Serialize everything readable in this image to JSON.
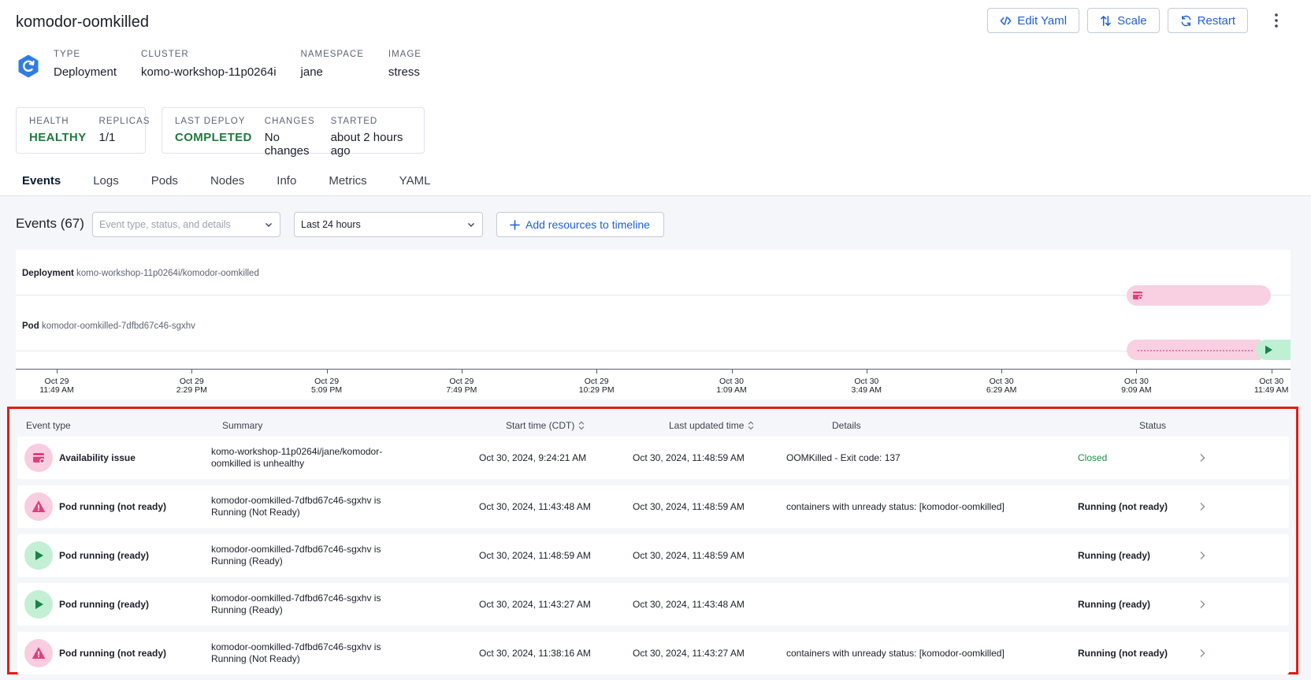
{
  "header": {
    "title": "komodor-oomkilled",
    "actions": {
      "edit_yaml": "Edit Yaml",
      "scale": "Scale",
      "restart": "Restart"
    }
  },
  "meta": {
    "type_label": "TYPE",
    "type_value": "Deployment",
    "cluster_label": "CLUSTER",
    "cluster_value": "komo-workshop-11p0264i",
    "namespace_label": "NAMESPACE",
    "namespace_value": "jane",
    "image_label": "IMAGE",
    "image_value": "stress"
  },
  "health_card": {
    "health_label": "HEALTH",
    "health_value": "HEALTHY",
    "replicas_label": "REPLICAS",
    "replicas_value": "1/1"
  },
  "deploy_card": {
    "last_deploy_label": "LAST DEPLOY",
    "last_deploy_value": "COMPLETED",
    "changes_label": "CHANGES",
    "changes_value": "No changes",
    "started_label": "STARTED",
    "started_value": "about 2 hours ago"
  },
  "tabs": [
    "Events",
    "Logs",
    "Pods",
    "Nodes",
    "Info",
    "Metrics",
    "YAML"
  ],
  "events": {
    "title": "Events (67)",
    "filter_placeholder": "Event type, status, and details",
    "time_range": "Last 24 hours",
    "add_resources": "Add resources to timeline"
  },
  "timeline": {
    "rows": [
      {
        "kind": "Deployment",
        "path": "komo-workshop-11p0264i/komodor-oomkilled"
      },
      {
        "kind": "Pod",
        "path": "komodor-oomkilled-7dfbd67c46-sgxhv"
      }
    ],
    "ticks": [
      {
        "date": "Oct 29",
        "time": "11:49 AM"
      },
      {
        "date": "Oct 29",
        "time": "2:29 PM"
      },
      {
        "date": "Oct 29",
        "time": "5:09 PM"
      },
      {
        "date": "Oct 29",
        "time": "7:49 PM"
      },
      {
        "date": "Oct 29",
        "time": "10:29 PM"
      },
      {
        "date": "Oct 30",
        "time": "1:09 AM"
      },
      {
        "date": "Oct 30",
        "time": "3:49 AM"
      },
      {
        "date": "Oct 30",
        "time": "6:29 AM"
      },
      {
        "date": "Oct 30",
        "time": "9:09 AM"
      },
      {
        "date": "Oct 30",
        "time": "11:49 AM"
      }
    ]
  },
  "table": {
    "headers": {
      "event_type": "Event type",
      "summary": "Summary",
      "start_time": "Start time (CDT)",
      "last_updated": "Last updated time",
      "details": "Details",
      "status": "Status"
    },
    "rows": [
      {
        "type": "Availability issue",
        "icon": "availability-icon",
        "summary": "komo-workshop-11p0264i/jane/komodor-oomkilled is unhealthy",
        "start": "Oct 30, 2024, 9:24:21 AM",
        "updated": "Oct 30, 2024, 11:48:59 AM",
        "details": "OOMKilled - Exit code: 137",
        "status": "Closed"
      },
      {
        "type": "Pod running (not ready)",
        "icon": "warning-icon",
        "summary": "komodor-oomkilled-7dfbd67c46-sgxhv is Running (Not Ready)",
        "start": "Oct 30, 2024, 11:43:48 AM",
        "updated": "Oct 30, 2024, 11:48:59 AM",
        "details": "containers with unready status: [komodor-oomkilled]",
        "status": "Running (not ready)"
      },
      {
        "type": "Pod running (ready)",
        "icon": "play-icon",
        "summary": "komodor-oomkilled-7dfbd67c46-sgxhv is Running (Ready)",
        "start": "Oct 30, 2024, 11:48:59 AM",
        "updated": "Oct 30, 2024, 11:48:59 AM",
        "details": "",
        "status": "Running (ready)"
      },
      {
        "type": "Pod running (ready)",
        "icon": "play-icon",
        "summary": "komodor-oomkilled-7dfbd67c46-sgxhv is Running (Ready)",
        "start": "Oct 30, 2024, 11:43:27 AM",
        "updated": "Oct 30, 2024, 11:43:48 AM",
        "details": "",
        "status": "Running (ready)"
      },
      {
        "type": "Pod running (not ready)",
        "icon": "warning-icon",
        "summary": "komodor-oomkilled-7dfbd67c46-sgxhv is Running (Not Ready)",
        "start": "Oct 30, 2024, 11:38:16 AM",
        "updated": "Oct 30, 2024, 11:43:27 AM",
        "details": "containers with unready status: [komodor-oomkilled]",
        "status": "Running (not ready)"
      }
    ]
  },
  "colors": {
    "accent": "#1f5fd6",
    "healthy": "#1f7a3f",
    "closed": "#1f8a46",
    "highlight_border": "#e31b1b",
    "pink_icon_bg": "#f8cde0",
    "green_icon_bg": "#c3efd4"
  }
}
